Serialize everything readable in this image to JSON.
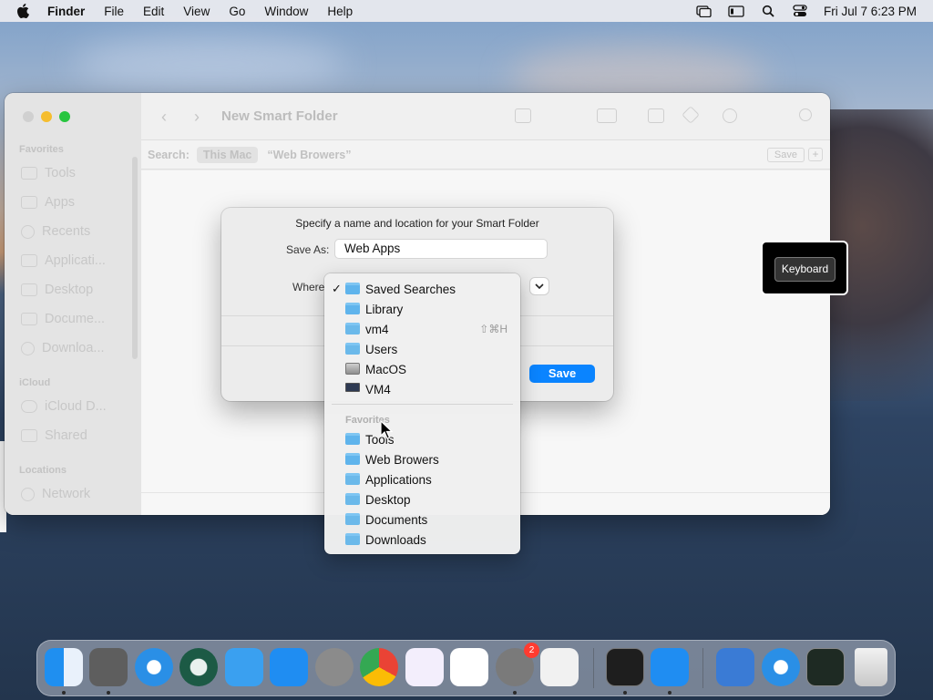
{
  "menubar": {
    "app_name": "Finder",
    "menus": [
      "File",
      "Edit",
      "View",
      "Go",
      "Window",
      "Help"
    ],
    "clock": "Fri Jul 7  6:23 PM"
  },
  "finder": {
    "title": "New Smart Folder",
    "search_label": "Search:",
    "scope_this_mac": "This Mac",
    "scope_query": "“Web Browers”",
    "save_small": "Save",
    "plus_small": "+",
    "sidebar": {
      "favorites_header": "Favorites",
      "favorites": [
        "Tools",
        "Apps",
        "Recents",
        "Applicati...",
        "Desktop",
        "Docume...",
        "Downloa..."
      ],
      "icloud_header": "iCloud",
      "icloud": [
        "iCloud D...",
        "Shared"
      ],
      "locations_header": "Locations",
      "locations": [
        "Network"
      ]
    }
  },
  "dialog": {
    "message": "Specify a name and location for your Smart Folder",
    "save_as_label": "Save As:",
    "save_as_value": "Web Apps",
    "where_label": "Where",
    "save_button": "Save"
  },
  "location_menu": {
    "selected": "Saved Searches",
    "items": [
      {
        "label": "Saved Searches",
        "icon": "folder-icon",
        "checked": true,
        "shortcut": ""
      },
      {
        "label": "Library",
        "icon": "folder-icon",
        "checked": false,
        "shortcut": ""
      },
      {
        "label": "vm4",
        "icon": "home-folder-icon",
        "checked": false,
        "shortcut": "⇧⌘H"
      },
      {
        "label": "Users",
        "icon": "folder-icon",
        "checked": false,
        "shortcut": ""
      },
      {
        "label": "MacOS",
        "icon": "drive-icon",
        "checked": false,
        "shortcut": ""
      },
      {
        "label": "VM4",
        "icon": "computer-icon",
        "checked": false,
        "shortcut": ""
      }
    ],
    "favorites_header": "Favorites",
    "favorites": [
      "Tools",
      "Web Browers",
      "Applications",
      "Desktop",
      "Documents",
      "Downloads"
    ]
  },
  "keyboard_overlay": {
    "label": "Keyboard"
  },
  "dock": {
    "apps": [
      {
        "name": "finder-icon",
        "color": "#3b9df0"
      },
      {
        "name": "pixelmator-icon",
        "color": "#6c6c6c"
      },
      {
        "name": "safari-icon",
        "color": "#2a8fe6"
      },
      {
        "name": "time-machine-icon",
        "color": "#1c5a45"
      },
      {
        "name": "testflight-icon",
        "color": "#3aa0f0"
      },
      {
        "name": "app-store-icon",
        "color": "#1f8df2"
      },
      {
        "name": "automator-icon",
        "color": "#8b8b8b"
      },
      {
        "name": "chrome-icon",
        "color": "#e8e8e8"
      },
      {
        "name": "visual-studio-icon",
        "color": "#7b4bc8"
      },
      {
        "name": "vscode-icon",
        "color": "#1f7bd6"
      },
      {
        "name": "system-settings-icon",
        "color": "#7a7a7a"
      },
      {
        "name": "launchpad-icon",
        "color": "#efefef"
      },
      {
        "name": "terminal-icon",
        "color": "#1e1e1e"
      },
      {
        "name": "app-store-2-icon",
        "color": "#1f8df2"
      },
      {
        "name": "xcode-icon",
        "color": "#3a7bd5"
      },
      {
        "name": "safari-2-icon",
        "color": "#2a8fe6"
      },
      {
        "name": "activity-monitor-icon",
        "color": "#222"
      },
      {
        "name": "trash-icon",
        "color": "#d8d8d8"
      }
    ],
    "settings_badge": "2"
  }
}
